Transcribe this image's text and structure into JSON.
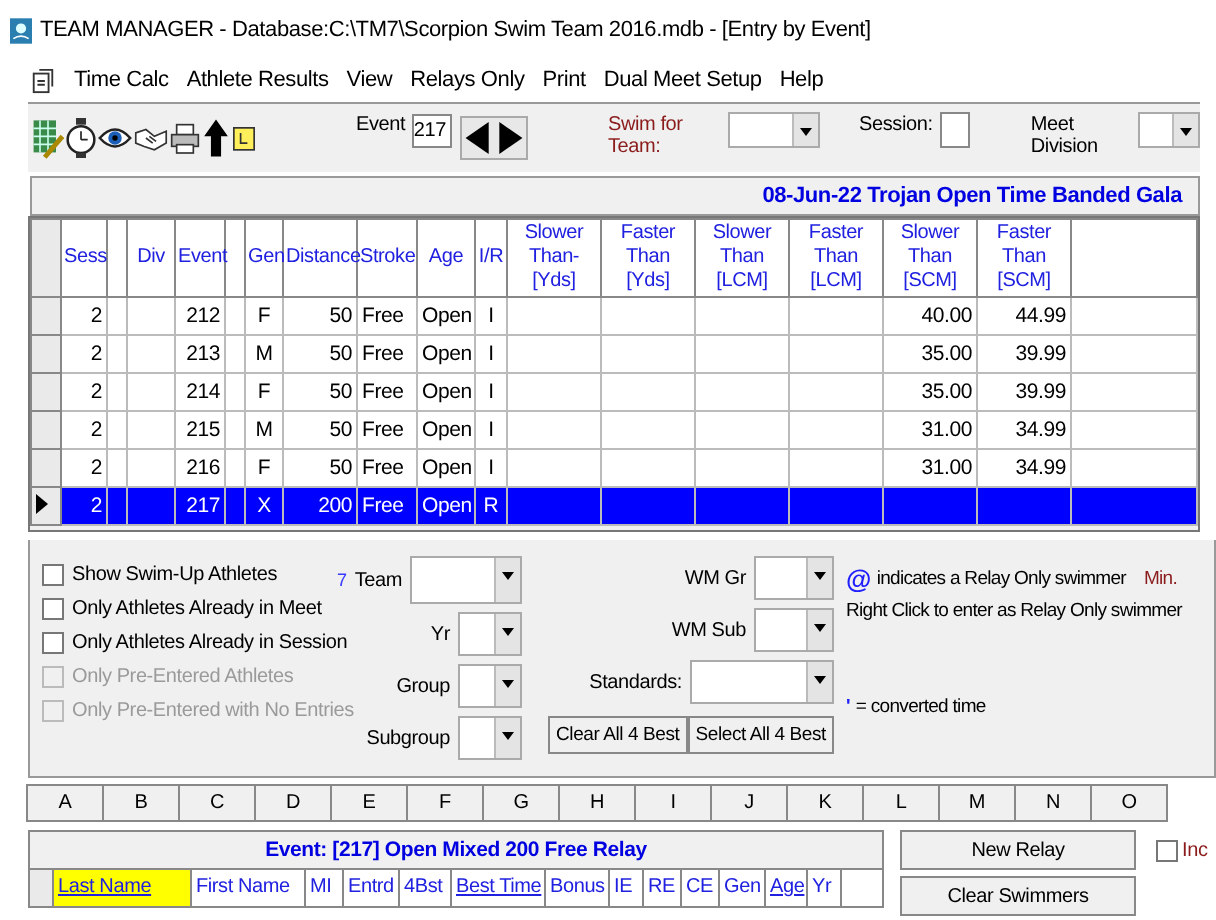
{
  "window": {
    "title": "TEAM MANAGER - Database:C:\\TM7\\Scorpion Swim Team 2016.mdb - [Entry by Event]"
  },
  "menu": [
    "Time Calc",
    "Athlete Results",
    "View",
    "Relays Only",
    "Print",
    "Dual Meet Setup",
    "Help"
  ],
  "toolbar": {
    "event_label": "Event",
    "event_value": "217",
    "swim_for_team_label": "Swim for Team:",
    "session_label": "Session:",
    "meet_division_label": "Meet Division"
  },
  "meet_banner": "08-Jun-22  Trojan Open Time Banded Gala",
  "events_table": {
    "columns": [
      "Sess",
      "Div",
      "Event",
      "Gen",
      "Distance",
      "Stroke",
      "Age",
      "I/R",
      "Slower Than-[Yds]",
      "Faster Than [Yds]",
      "Slower Than [LCM]",
      "Faster Than [LCM]",
      "Slower Than [SCM]",
      "Faster Than [SCM]"
    ],
    "rows": [
      {
        "selected": false,
        "sess": "2",
        "event": "212",
        "gen": "F",
        "distance": "50",
        "stroke": "Free",
        "age": "Open",
        "ir": "I",
        "slower_scm": "40.00",
        "faster_scm": "44.99"
      },
      {
        "selected": false,
        "sess": "2",
        "event": "213",
        "gen": "M",
        "distance": "50",
        "stroke": "Free",
        "age": "Open",
        "ir": "I",
        "slower_scm": "35.00",
        "faster_scm": "39.99"
      },
      {
        "selected": false,
        "sess": "2",
        "event": "214",
        "gen": "F",
        "distance": "50",
        "stroke": "Free",
        "age": "Open",
        "ir": "I",
        "slower_scm": "35.00",
        "faster_scm": "39.99"
      },
      {
        "selected": false,
        "sess": "2",
        "event": "215",
        "gen": "M",
        "distance": "50",
        "stroke": "Free",
        "age": "Open",
        "ir": "I",
        "slower_scm": "31.00",
        "faster_scm": "34.99"
      },
      {
        "selected": false,
        "sess": "2",
        "event": "216",
        "gen": "F",
        "distance": "50",
        "stroke": "Free",
        "age": "Open",
        "ir": "I",
        "slower_scm": "31.00",
        "faster_scm": "34.99"
      },
      {
        "selected": true,
        "sess": "2",
        "event": "217",
        "gen": "X",
        "distance": "200",
        "stroke": "Free",
        "age": "Open",
        "ir": "R"
      }
    ]
  },
  "filters": {
    "checkboxes": [
      {
        "label": "Show Swim-Up Athletes",
        "checked": false,
        "disabled": false
      },
      {
        "label": "Only Athletes Already in Meet",
        "checked": false,
        "disabled": false
      },
      {
        "label": "Only Athletes Already in Session",
        "checked": false,
        "disabled": false
      },
      {
        "label": "Only Pre-Entered Athletes",
        "checked": false,
        "disabled": true
      },
      {
        "label": "Only Pre-Entered with No Entries",
        "checked": false,
        "disabled": true
      }
    ],
    "team_marker": "7",
    "left_dropdowns": [
      "Team",
      "Yr",
      "Group",
      "Subgroup"
    ],
    "right_dropdowns": [
      "WM Gr",
      "WM Sub",
      "Standards:"
    ],
    "buttons": [
      "Clear All 4 Best",
      "Select All 4 Best"
    ],
    "relay_symbol": "@",
    "relay_note": "indicates a Relay Only swimmer",
    "min_label": "Min.",
    "right_click_note": "Right Click to enter as Relay Only swimmer",
    "converted_symbol": "'",
    "converted_note": "= converted time"
  },
  "sheet_columns": [
    "A",
    "B",
    "C",
    "D",
    "E",
    "F",
    "G",
    "H",
    "I",
    "J",
    "K",
    "L",
    "M",
    "N",
    "O"
  ],
  "relay": {
    "title": "Event: [217]  Open  Mixed  200  Free Relay",
    "columns": [
      {
        "label": "Last Name",
        "link": true,
        "highlighted": true
      },
      {
        "label": "First Name",
        "link": false,
        "highlighted": false
      },
      {
        "label": "MI",
        "link": false,
        "highlighted": false
      },
      {
        "label": "Entrd",
        "link": false,
        "highlighted": false
      },
      {
        "label": "4Bst",
        "link": false,
        "highlighted": false
      },
      {
        "label": "Best Time",
        "link": true,
        "highlighted": false
      },
      {
        "label": "Bonus",
        "link": false,
        "highlighted": false
      },
      {
        "label": "IE",
        "link": false,
        "highlighted": false
      },
      {
        "label": "RE",
        "link": false,
        "highlighted": false
      },
      {
        "label": "CE",
        "link": false,
        "highlighted": false
      },
      {
        "label": "Gen",
        "link": false,
        "highlighted": false
      },
      {
        "label": "Age",
        "link": true,
        "highlighted": false
      },
      {
        "label": "Yr",
        "link": false,
        "highlighted": false
      }
    ],
    "buttons": [
      "New Relay",
      "Clear Swimmers"
    ],
    "include_label": "Inc",
    "include_checked": false
  }
}
